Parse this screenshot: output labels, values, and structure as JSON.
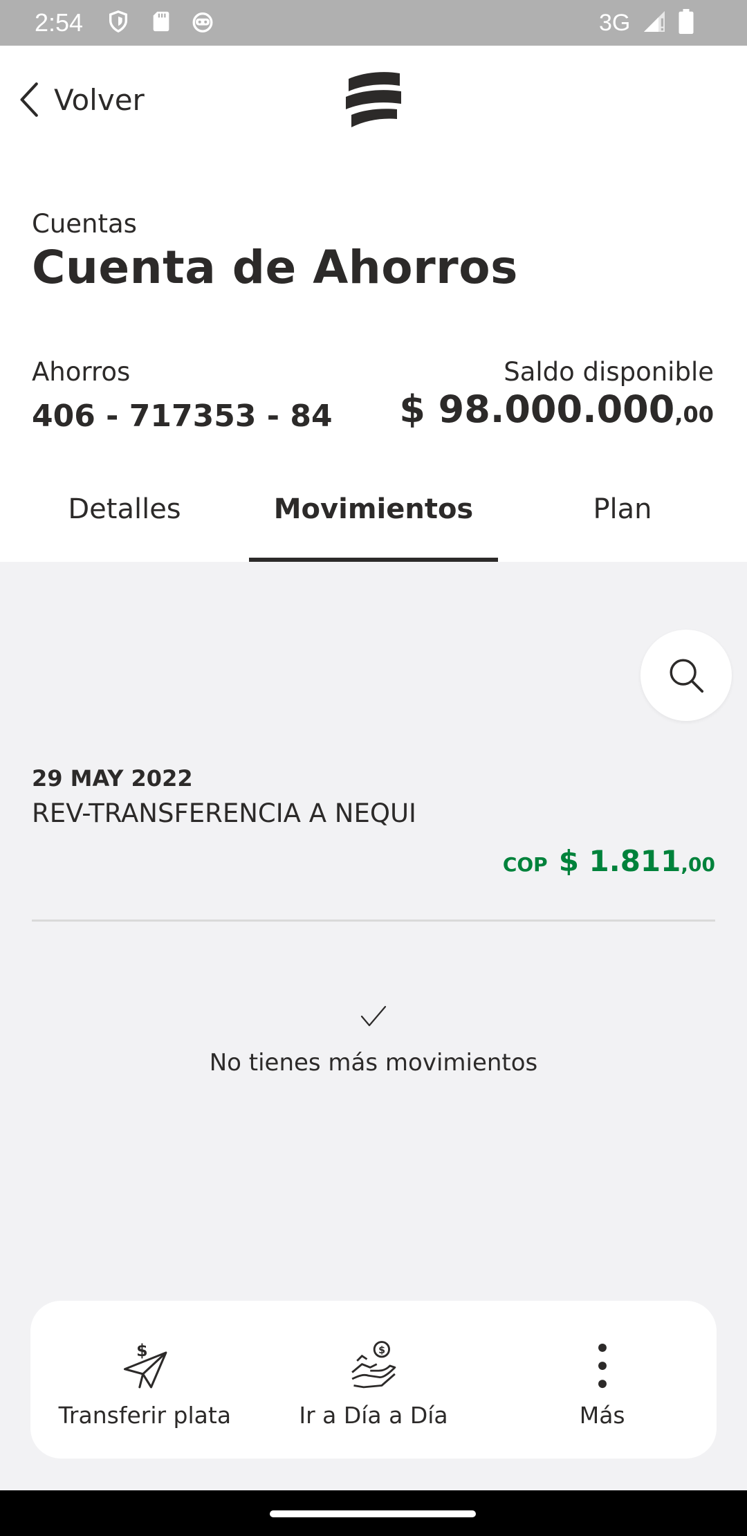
{
  "status_bar": {
    "time": "2:54",
    "network": "3G",
    "icons": [
      "shield-icon",
      "sd-card-icon",
      "android-head-icon",
      "signal-icon",
      "battery-icon"
    ]
  },
  "header": {
    "back_label": "Volver",
    "logo_icon": "bancolombia-logo"
  },
  "page": {
    "breadcrumb": "Cuentas",
    "title": "Cuenta de Ahorros"
  },
  "account": {
    "type": "Ahorros",
    "number": "406 - 717353 - 84",
    "balance_label": "Saldo disponible",
    "balance_integer": "$ 98.000.000",
    "balance_decimal": ",00"
  },
  "tabs": [
    {
      "label": "Detalles",
      "active": false
    },
    {
      "label": "Movimientos",
      "active": true
    },
    {
      "label": "Plan",
      "active": false
    }
  ],
  "movements": [
    {
      "date": "29 MAY 2022",
      "description": "REV-TRANSFERENCIA A NEQUI",
      "currency": "COP",
      "amount_integer": "$ 1.811",
      "amount_decimal": ",00"
    }
  ],
  "end_message": "No tienes más movimientos",
  "actions": [
    {
      "label": "Transferir plata",
      "icon": "send-money-icon"
    },
    {
      "label": "Ir a Día a Día",
      "icon": "hand-money-icon"
    },
    {
      "label": "Más",
      "icon": "more-vertical-icon"
    }
  ],
  "colors": {
    "positive_amount": "#00823b",
    "text": "#2c2a29",
    "background": "#f2f2f4"
  }
}
